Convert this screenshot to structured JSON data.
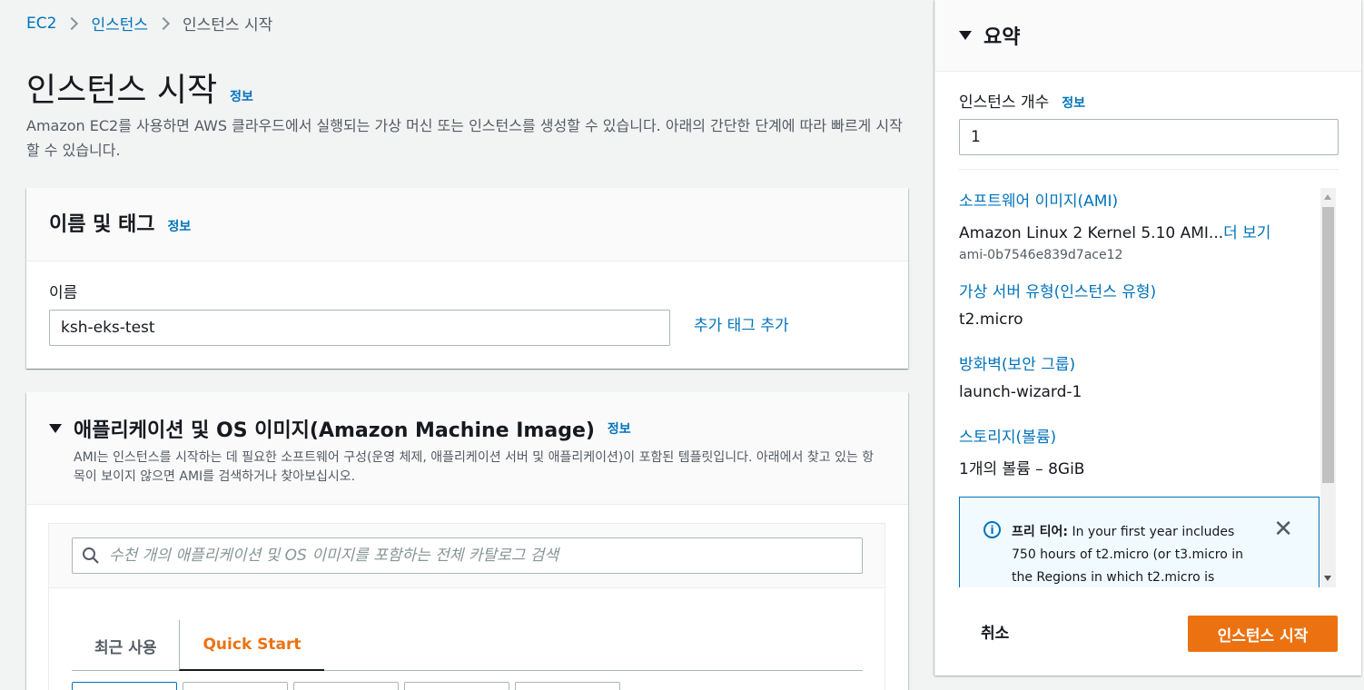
{
  "breadcrumb": {
    "items": [
      "EC2",
      "인스턴스",
      "인스턴스 시작"
    ]
  },
  "page": {
    "title": "인스턴스 시작",
    "info": "정보",
    "description": "Amazon EC2를 사용하면 AWS 클라우드에서 실행되는 가상 머신 또는 인스턴스를 생성할 수 있습니다. 아래의 간단한 단계에 따라 빠르게 시작할 수 있습니다."
  },
  "name_panel": {
    "title": "이름 및 태그",
    "info": "정보",
    "name_label": "이름",
    "name_value": "ksh-eks-test",
    "add_tag": "추가 태그 추가"
  },
  "ami_panel": {
    "title": "애플리케이션 및 OS 이미지(Amazon Machine Image)",
    "info": "정보",
    "description": "AMI는 인스턴스를 시작하는 데 필요한 소프트웨어 구성(운영 체제, 애플리케이션 서버 및 애플리케이션)이 포함된 템플릿입니다. 아래에서 찾고 있는 항목이 보이지 않으면 AMI를 검색하거나 찾아보십시오.",
    "search_placeholder": "수천 개의 애플리케이션 및 OS 이미지를 포함하는 전체 카탈로그 검색",
    "tabs": [
      "최근 사용",
      "Quick Start"
    ]
  },
  "summary": {
    "title": "요약",
    "count_label": "인스턴스 개수",
    "count_info": "정보",
    "count_value": "1",
    "ami_title": "소프트웨어 이미지(AMI)",
    "ami_value": "Amazon Linux 2 Kernel 5.10 AMI...",
    "ami_more": "더 보기",
    "ami_id": "ami-0b7546e839d7ace12",
    "type_title": "가상 서버 유형(인스턴스 유형)",
    "type_value": "t2.micro",
    "fw_title": "방화벽(보안 그룹)",
    "fw_value": "launch-wizard-1",
    "storage_title": "스토리지(볼륨)",
    "storage_value": "1개의 볼륨 – 8GiB",
    "free_tier_label": "프리 티어:",
    "free_tier_text": "In your first year includes 750 hours of t2.micro (or t3.micro in the Regions in which t2.micro is",
    "cancel": "취소",
    "launch": "인스턴스 시작"
  }
}
